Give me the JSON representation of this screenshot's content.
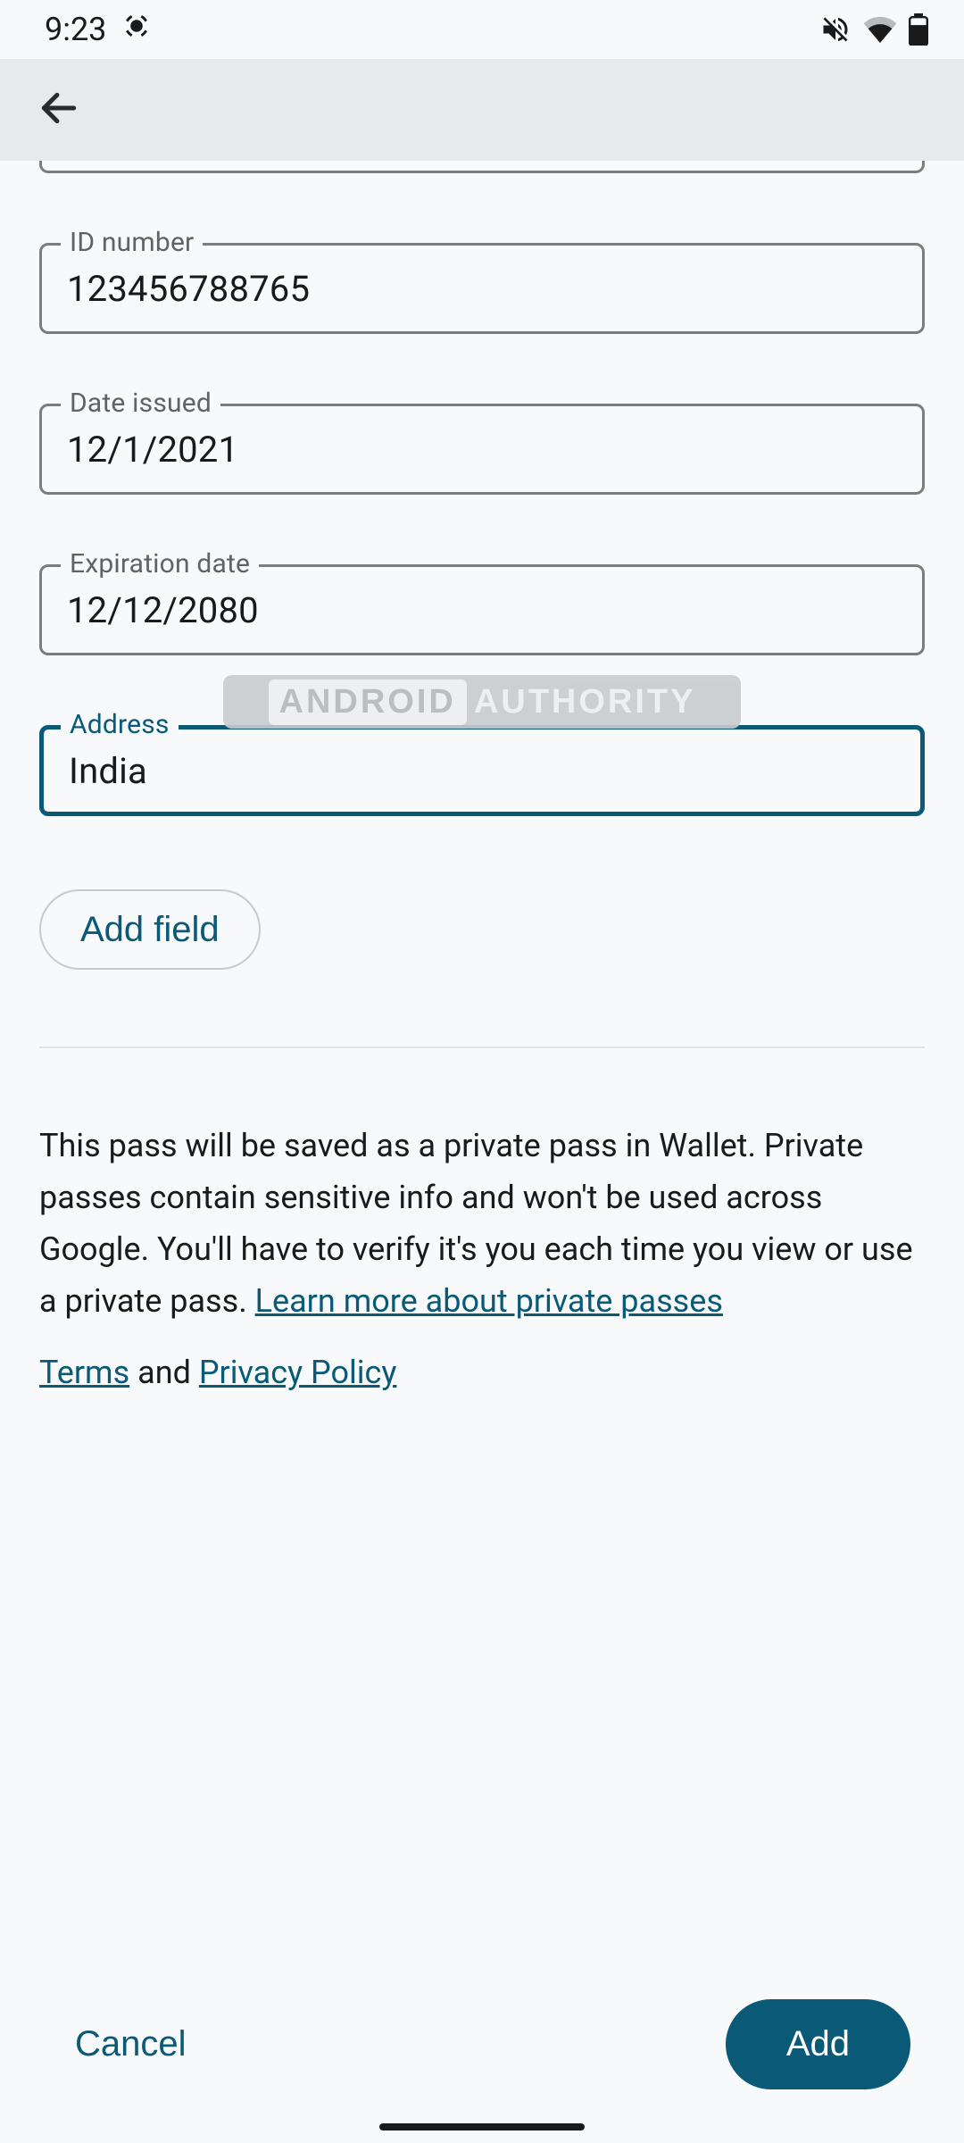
{
  "status": {
    "time": "9:23"
  },
  "form": {
    "fields": [
      {
        "label": "ID number",
        "value": "123456788765"
      },
      {
        "label": "Date issued",
        "value": "12/1/2021"
      },
      {
        "label": "Expiration date",
        "value": "12/12/2080"
      },
      {
        "label": "Address",
        "value": "India"
      }
    ],
    "add_field_label": "Add field"
  },
  "disclosure": {
    "text": "This pass will be saved as a private pass in Wallet. Private passes contain sensitive info and won't be used across Google. You'll have to verify it's you each time you view or use a private pass. ",
    "learn_more": "Learn more about private passes"
  },
  "legal": {
    "terms": "Terms",
    "and": " and ",
    "privacy": "Privacy Policy"
  },
  "actions": {
    "cancel": "Cancel",
    "add": "Add"
  },
  "watermark": {
    "left": "ANDROID",
    "right": "AUTHORITY"
  },
  "colors": {
    "accent": "#0a5a77",
    "border": "#7a7d80",
    "bg": "#f7f9fb"
  }
}
